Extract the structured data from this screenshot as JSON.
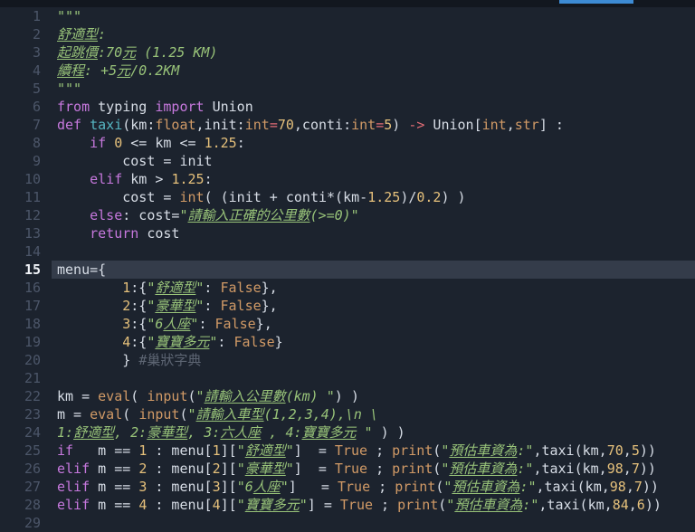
{
  "palette": {
    "editor_bg": "#1c232e",
    "topbar_bg": "#12171f",
    "scroll_thumb": "#3d8bd4",
    "current_line_bg": "#343c4a",
    "line_number": "#4c5669",
    "active_line_number": "#eef1f6",
    "plain": "#d7dde6",
    "keyword": "#c678dd",
    "function_name": "#56b6c2",
    "builtin_type": "#d19a66",
    "number": "#e5c07b",
    "operator": "#e06c75",
    "string": "#98c379",
    "comment": "#5d6573"
  },
  "editor": {
    "current_line": 15,
    "lines": [
      {
        "n": 1,
        "segs": [
          [
            "str",
            "\"\"\""
          ]
        ]
      },
      {
        "n": 2,
        "segs": [
          [
            "cjk",
            "舒適型"
          ],
          [
            "str",
            ":"
          ]
        ]
      },
      {
        "n": 3,
        "segs": [
          [
            "cjk",
            "起跳價"
          ],
          [
            "str",
            ":70"
          ],
          [
            "cjk",
            "元"
          ],
          [
            "str",
            " (1.25 KM)"
          ]
        ]
      },
      {
        "n": 4,
        "segs": [
          [
            "cjk",
            "續程"
          ],
          [
            "str",
            ": +5"
          ],
          [
            "cjk",
            "元"
          ],
          [
            "str",
            "/0.2KM"
          ]
        ]
      },
      {
        "n": 5,
        "segs": [
          [
            "str",
            "\"\"\""
          ]
        ]
      },
      {
        "n": 6,
        "segs": [
          [
            "kw",
            "from"
          ],
          [
            "pl",
            " typing "
          ],
          [
            "kw",
            "import"
          ],
          [
            "pl",
            " Union"
          ]
        ]
      },
      {
        "n": 7,
        "segs": [
          [
            "kw",
            "def"
          ],
          [
            "pl",
            " "
          ],
          [
            "fn",
            "taxi"
          ],
          [
            "pl",
            "(km:"
          ],
          [
            "typ",
            "float"
          ],
          [
            "pl",
            ",init:"
          ],
          [
            "typ",
            "int"
          ],
          [
            "op",
            "="
          ],
          [
            "num",
            "70"
          ],
          [
            "pl",
            ",conti:"
          ],
          [
            "typ",
            "int"
          ],
          [
            "op",
            "="
          ],
          [
            "num",
            "5"
          ],
          [
            "pl",
            ") "
          ],
          [
            "op",
            "->"
          ],
          [
            "pl",
            " Union["
          ],
          [
            "typ",
            "int"
          ],
          [
            "pl",
            ","
          ],
          [
            "typ",
            "str"
          ],
          [
            "pl",
            "] :"
          ]
        ]
      },
      {
        "n": 8,
        "segs": [
          [
            "pl",
            "    "
          ],
          [
            "kw",
            "if"
          ],
          [
            "pl",
            " "
          ],
          [
            "num",
            "0"
          ],
          [
            "pl",
            " <= km <= "
          ],
          [
            "num",
            "1.25"
          ],
          [
            "pl",
            ":"
          ]
        ]
      },
      {
        "n": 9,
        "segs": [
          [
            "pl",
            "        cost = init"
          ]
        ]
      },
      {
        "n": 10,
        "segs": [
          [
            "pl",
            "    "
          ],
          [
            "kw",
            "elif"
          ],
          [
            "pl",
            " km > "
          ],
          [
            "num",
            "1.25"
          ],
          [
            "pl",
            ":"
          ]
        ]
      },
      {
        "n": 11,
        "segs": [
          [
            "pl",
            "        cost = "
          ],
          [
            "typ",
            "int"
          ],
          [
            "pl",
            "( (init + conti*(km-"
          ],
          [
            "num",
            "1.25"
          ],
          [
            "pl",
            ")/"
          ],
          [
            "num",
            "0.2"
          ],
          [
            "pl",
            ") )"
          ]
        ]
      },
      {
        "n": 12,
        "segs": [
          [
            "pl",
            "    "
          ],
          [
            "kw",
            "else"
          ],
          [
            "pl",
            ": cost="
          ],
          [
            "str",
            "\""
          ],
          [
            "cjk",
            "請輸入正確的公里數"
          ],
          [
            "str",
            "(>=0)\""
          ]
        ]
      },
      {
        "n": 13,
        "segs": [
          [
            "pl",
            "    "
          ],
          [
            "kw",
            "return"
          ],
          [
            "pl",
            " cost"
          ]
        ]
      },
      {
        "n": 14,
        "segs": []
      },
      {
        "n": 15,
        "segs": [
          [
            "pl",
            "menu={"
          ]
        ]
      },
      {
        "n": 16,
        "segs": [
          [
            "pl",
            "        "
          ],
          [
            "num",
            "1"
          ],
          [
            "pl",
            ":{"
          ],
          [
            "str",
            "\""
          ],
          [
            "cjk",
            "舒適型"
          ],
          [
            "str",
            "\""
          ],
          [
            "pl",
            ": "
          ],
          [
            "typ",
            "False"
          ],
          [
            "pl",
            "},"
          ]
        ]
      },
      {
        "n": 17,
        "segs": [
          [
            "pl",
            "        "
          ],
          [
            "num",
            "2"
          ],
          [
            "pl",
            ":{"
          ],
          [
            "str",
            "\""
          ],
          [
            "cjk",
            "豪華型"
          ],
          [
            "str",
            "\""
          ],
          [
            "pl",
            ": "
          ],
          [
            "typ",
            "False"
          ],
          [
            "pl",
            "},"
          ]
        ]
      },
      {
        "n": 18,
        "segs": [
          [
            "pl",
            "        "
          ],
          [
            "num",
            "3"
          ],
          [
            "pl",
            ":{"
          ],
          [
            "str",
            "\"6"
          ],
          [
            "cjk",
            "人座"
          ],
          [
            "str",
            "\""
          ],
          [
            "pl",
            ": "
          ],
          [
            "typ",
            "False"
          ],
          [
            "pl",
            "},"
          ]
        ]
      },
      {
        "n": 19,
        "segs": [
          [
            "pl",
            "        "
          ],
          [
            "num",
            "4"
          ],
          [
            "pl",
            ":{"
          ],
          [
            "str",
            "\""
          ],
          [
            "cjk",
            "寶寶多元"
          ],
          [
            "str",
            "\""
          ],
          [
            "pl",
            ": "
          ],
          [
            "typ",
            "False"
          ],
          [
            "pl",
            "}"
          ]
        ]
      },
      {
        "n": 20,
        "segs": [
          [
            "pl",
            "        } "
          ],
          [
            "com",
            "#巢狀字典"
          ]
        ]
      },
      {
        "n": 21,
        "segs": []
      },
      {
        "n": 22,
        "segs": [
          [
            "pl",
            "km = "
          ],
          [
            "typ",
            "eval"
          ],
          [
            "pl",
            "( "
          ],
          [
            "typ",
            "input"
          ],
          [
            "pl",
            "("
          ],
          [
            "str",
            "\""
          ],
          [
            "cjk",
            "請輸入公里數"
          ],
          [
            "str",
            "(km) \""
          ],
          [
            "pl",
            ") )"
          ]
        ]
      },
      {
        "n": 23,
        "segs": [
          [
            "pl",
            "m = "
          ],
          [
            "typ",
            "eval"
          ],
          [
            "pl",
            "( "
          ],
          [
            "typ",
            "input"
          ],
          [
            "pl",
            "("
          ],
          [
            "str",
            "\""
          ],
          [
            "cjk",
            "請輸入車型"
          ],
          [
            "str",
            "(1,2,3,4),\\n \\"
          ]
        ]
      },
      {
        "n": 24,
        "segs": [
          [
            "str",
            "1:"
          ],
          [
            "cjk",
            "舒適型"
          ],
          [
            "str",
            ", 2:"
          ],
          [
            "cjk",
            "豪華型"
          ],
          [
            "str",
            ", 3:"
          ],
          [
            "cjk",
            "六人座"
          ],
          [
            "str",
            " , 4:"
          ],
          [
            "cjk",
            "寶寶多元"
          ],
          [
            "str",
            " \""
          ],
          [
            "pl",
            " ) )"
          ]
        ]
      },
      {
        "n": 25,
        "segs": [
          [
            "kw",
            "if"
          ],
          [
            "pl",
            "   m == "
          ],
          [
            "num",
            "1"
          ],
          [
            "pl",
            " : menu["
          ],
          [
            "num",
            "1"
          ],
          [
            "pl",
            "]["
          ],
          [
            "str",
            "\""
          ],
          [
            "cjk",
            "舒適型"
          ],
          [
            "str",
            "\""
          ],
          [
            "pl",
            "]  = "
          ],
          [
            "typ",
            "True"
          ],
          [
            "pl",
            " ; "
          ],
          [
            "typ",
            "print"
          ],
          [
            "pl",
            "("
          ],
          [
            "str",
            "\""
          ],
          [
            "cjk",
            "預估車資為"
          ],
          [
            "str",
            ":\""
          ],
          [
            "pl",
            ",taxi(km,"
          ],
          [
            "num",
            "70"
          ],
          [
            "pl",
            ","
          ],
          [
            "num",
            "5"
          ],
          [
            "pl",
            "))"
          ]
        ]
      },
      {
        "n": 26,
        "segs": [
          [
            "kw",
            "elif"
          ],
          [
            "pl",
            " m == "
          ],
          [
            "num",
            "2"
          ],
          [
            "pl",
            " : menu["
          ],
          [
            "num",
            "2"
          ],
          [
            "pl",
            "]["
          ],
          [
            "str",
            "\""
          ],
          [
            "cjk",
            "豪華型"
          ],
          [
            "str",
            "\""
          ],
          [
            "pl",
            "]  = "
          ],
          [
            "typ",
            "True"
          ],
          [
            "pl",
            " ; "
          ],
          [
            "typ",
            "print"
          ],
          [
            "pl",
            "("
          ],
          [
            "str",
            "\""
          ],
          [
            "cjk",
            "預估車資為"
          ],
          [
            "str",
            ":\""
          ],
          [
            "pl",
            ",taxi(km,"
          ],
          [
            "num",
            "98"
          ],
          [
            "pl",
            ","
          ],
          [
            "num",
            "7"
          ],
          [
            "pl",
            "))"
          ]
        ]
      },
      {
        "n": 27,
        "segs": [
          [
            "kw",
            "elif"
          ],
          [
            "pl",
            " m == "
          ],
          [
            "num",
            "3"
          ],
          [
            "pl",
            " : menu["
          ],
          [
            "num",
            "3"
          ],
          [
            "pl",
            "]["
          ],
          [
            "str",
            "\"6"
          ],
          [
            "cjk",
            "人座"
          ],
          [
            "str",
            "\""
          ],
          [
            "pl",
            "]   = "
          ],
          [
            "typ",
            "True"
          ],
          [
            "pl",
            " ; "
          ],
          [
            "typ",
            "print"
          ],
          [
            "pl",
            "("
          ],
          [
            "str",
            "\""
          ],
          [
            "cjk",
            "預估車資為"
          ],
          [
            "str",
            ":\""
          ],
          [
            "pl",
            ",taxi(km,"
          ],
          [
            "num",
            "98"
          ],
          [
            "pl",
            ","
          ],
          [
            "num",
            "7"
          ],
          [
            "pl",
            "))"
          ]
        ]
      },
      {
        "n": 28,
        "segs": [
          [
            "kw",
            "elif"
          ],
          [
            "pl",
            " m == "
          ],
          [
            "num",
            "4"
          ],
          [
            "pl",
            " : menu["
          ],
          [
            "num",
            "4"
          ],
          [
            "pl",
            "]["
          ],
          [
            "str",
            "\""
          ],
          [
            "cjk",
            "寶寶多元"
          ],
          [
            "str",
            "\""
          ],
          [
            "pl",
            "] = "
          ],
          [
            "typ",
            "True"
          ],
          [
            "pl",
            " ; "
          ],
          [
            "typ",
            "print"
          ],
          [
            "pl",
            "("
          ],
          [
            "str",
            "\""
          ],
          [
            "cjk",
            "預估車資為"
          ],
          [
            "str",
            ":\""
          ],
          [
            "pl",
            ",taxi(km,"
          ],
          [
            "num",
            "84"
          ],
          [
            "pl",
            ","
          ],
          [
            "num",
            "6"
          ],
          [
            "pl",
            "))"
          ]
        ]
      },
      {
        "n": 29,
        "segs": []
      }
    ]
  }
}
